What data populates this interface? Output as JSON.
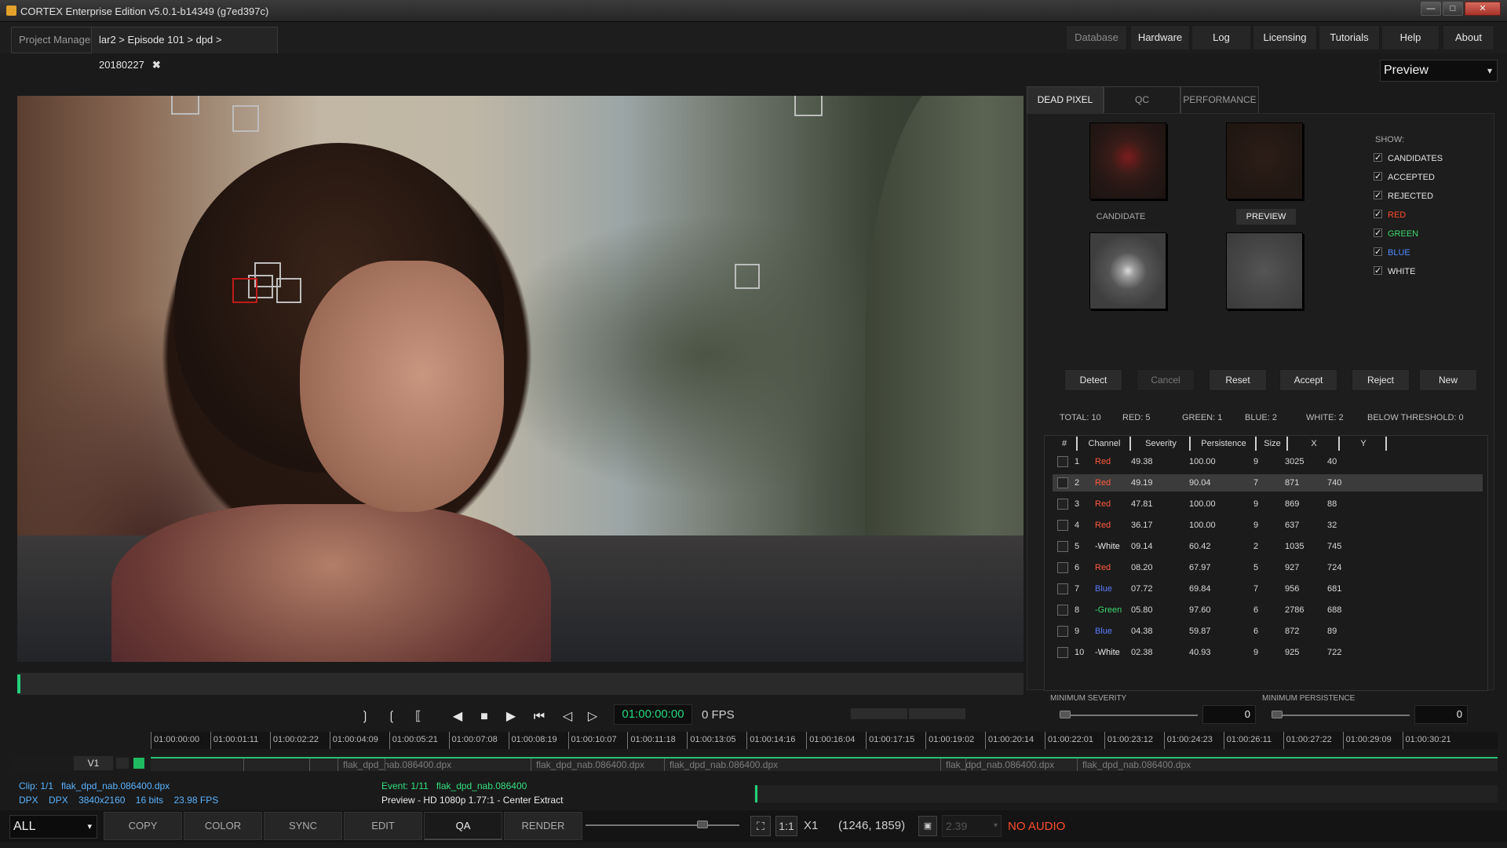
{
  "window": {
    "title": "CORTEX Enterprise Edition v5.0.1-b14349 (g7ed397c)",
    "min": "—",
    "max": "□",
    "close": "✕"
  },
  "tabs": {
    "project_manager": "Project Manager",
    "breadcrumb": "lar2 > Episode 101 > dpd > 20180227",
    "close": "✖"
  },
  "topnav": [
    "Database",
    "Hardware",
    "Log",
    "Licensing",
    "Tutorials",
    "Help",
    "About"
  ],
  "preview_select": {
    "value": "Preview",
    "chevron": "chevron-down-icon"
  },
  "transport": {
    "timecode": "01:00:00:00",
    "fps": "0 FPS",
    "buttons": [
      "mark-out",
      "mark-in",
      "mark-in-out",
      "prev",
      "stop",
      "play",
      "goto-start",
      "step-back",
      "step-forward"
    ]
  },
  "timeline": {
    "ticks": [
      "01:00:00:00",
      "01:00:01:11",
      "01:00:02:22",
      "01:00:04:09",
      "01:00:05:21",
      "01:00:07:08",
      "01:00:08:19",
      "01:00:10:07",
      "01:00:11:18",
      "01:00:13:05",
      "01:00:14:16",
      "01:00:16:04",
      "01:00:17:15",
      "01:00:19:02",
      "01:00:20:14",
      "01:00:22:01",
      "01:00:23:12",
      "01:00:24:23",
      "01:00:26:11",
      "01:00:27:22",
      "01:00:29:09",
      "01:00:30:21"
    ],
    "track_label": "V1",
    "clips": [
      "flak_dpd_nab.086400.dpx",
      "flak_dpd_nab.086400.dpx",
      "flak_dpd_nab.086400.dpx",
      "flak_dpd_nab.086400.dpx",
      "flak_dpd_nab.086400.dpx"
    ]
  },
  "clipinfo": {
    "clip": "Clip: 1/1",
    "clip_name": "flak_dpd_nab.086400.dpx",
    "fmt1": "DPX",
    "fmt2": "DPX",
    "res": "3840x2160",
    "bits": "16 bits",
    "fps": "23.98 FPS",
    "event": "Event: 1/11",
    "event_name": "flak_dpd_nab.086400",
    "preview_mode": "Preview - HD 1080p 1.77:1 - Center Extract"
  },
  "bottom": {
    "filter": "ALL",
    "modes": [
      "COPY",
      "COLOR",
      "SYNC",
      "EDIT",
      "QA",
      "RENDER"
    ],
    "active_mode": "QA",
    "zoom_label": "1:1",
    "speed": "X1",
    "coords": "(1246, 1859)",
    "aspect": "2.39",
    "audio": "NO AUDIO"
  },
  "panel": {
    "tabs": [
      "DEAD PIXEL",
      "QC",
      "PERFORMANCE"
    ],
    "active_tab": "DEAD PIXEL",
    "candidate_label": "CANDIDATE",
    "preview_button": "PREVIEW",
    "show_label": "SHOW:",
    "show": [
      {
        "label": "CANDIDATES",
        "color": "#e2e2e2"
      },
      {
        "label": "ACCEPTED",
        "color": "#e2e2e2"
      },
      {
        "label": "REJECTED",
        "color": "#e2e2e2"
      },
      {
        "label": "RED",
        "color": "#ff4b2b"
      },
      {
        "label": "GREEN",
        "color": "#3bd86b"
      },
      {
        "label": "BLUE",
        "color": "#4f8bff"
      },
      {
        "label": "WHITE",
        "color": "#e2e2e2"
      }
    ],
    "actions": [
      "Detect",
      "Cancel",
      "Reset",
      "Accept",
      "Reject",
      "New"
    ],
    "stats": {
      "total": "TOTAL: 10",
      "red": "RED: 5",
      "green": "GREEN: 1",
      "blue": "BLUE: 2",
      "white": "WHITE: 2",
      "below": "BELOW THRESHOLD: 0"
    },
    "columns": [
      "#",
      "Channel",
      "Severity",
      "Persistence",
      "Size",
      "X",
      "Y"
    ],
    "rows": [
      {
        "n": "1",
        "channel": "Red",
        "severity": "49.38",
        "persistence": "100.00",
        "size": "9",
        "x": "3025",
        "y": "40"
      },
      {
        "n": "2",
        "channel": "Red",
        "severity": "49.19",
        "persistence": "90.04",
        "size": "7",
        "x": "871",
        "y": "740"
      },
      {
        "n": "3",
        "channel": "Red",
        "severity": "47.81",
        "persistence": "100.00",
        "size": "9",
        "x": "869",
        "y": "88"
      },
      {
        "n": "4",
        "channel": "Red",
        "severity": "36.17",
        "persistence": "100.00",
        "size": "9",
        "x": "637",
        "y": "32"
      },
      {
        "n": "5",
        "channel": "-White",
        "severity": "09.14",
        "persistence": "60.42",
        "size": "2",
        "x": "1035",
        "y": "745"
      },
      {
        "n": "6",
        "channel": "Red",
        "severity": "08.20",
        "persistence": "67.97",
        "size": "5",
        "x": "927",
        "y": "724"
      },
      {
        "n": "7",
        "channel": "Blue",
        "severity": "07.72",
        "persistence": "69.84",
        "size": "7",
        "x": "956",
        "y": "681"
      },
      {
        "n": "8",
        "channel": "-Green",
        "severity": "05.80",
        "persistence": "97.60",
        "size": "6",
        "x": "2786",
        "y": "688"
      },
      {
        "n": "9",
        "channel": "Blue",
        "severity": "04.38",
        "persistence": "59.87",
        "size": "6",
        "x": "872",
        "y": "89"
      },
      {
        "n": "10",
        "channel": "-White",
        "severity": "02.38",
        "persistence": "40.93",
        "size": "9",
        "x": "925",
        "y": "722"
      }
    ],
    "selected_row": 2,
    "min_severity_label": "MINIMUM SEVERITY",
    "min_severity": "0",
    "min_persistence_label": "MINIMUM PERSISTENCE",
    "min_persistence": "0"
  }
}
